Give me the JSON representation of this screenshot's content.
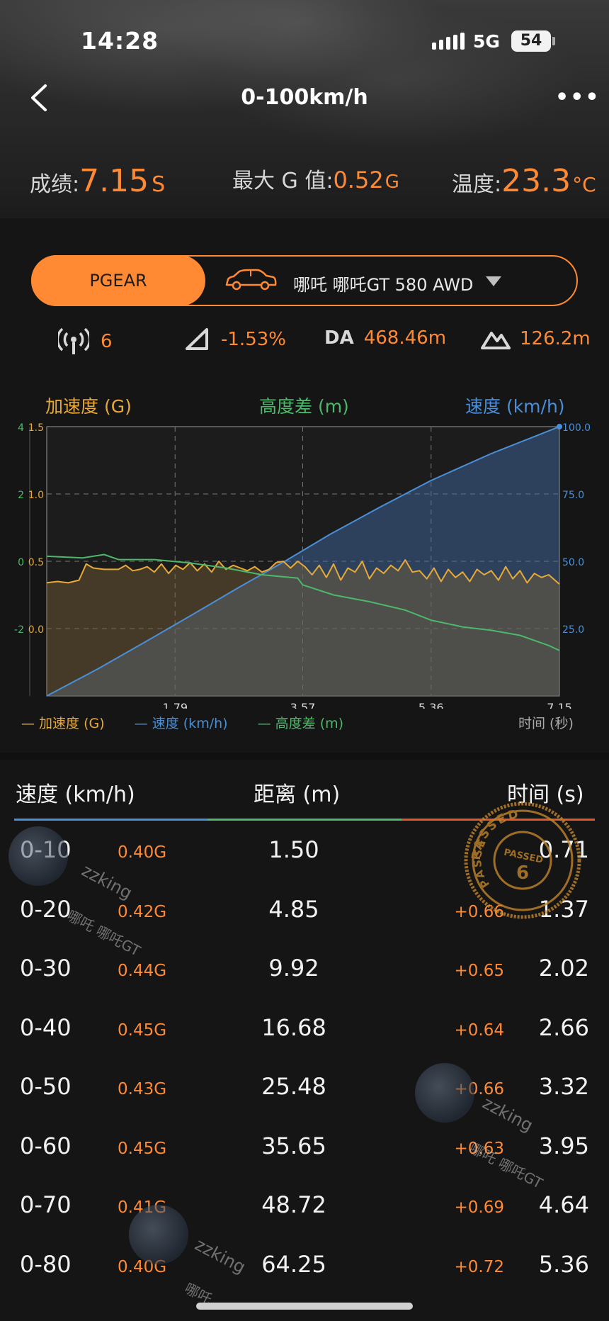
{
  "status_bar": {
    "time": "14:28",
    "network": "5G",
    "battery": "54"
  },
  "nav": {
    "title": "0-100km/h"
  },
  "metrics": [
    {
      "label": "成绩:",
      "value": "7.15",
      "unit": "S"
    },
    {
      "label": "最大 G 值:",
      "value": "0.52",
      "unit": "G"
    },
    {
      "label": "温度:",
      "value": "23.3",
      "unit": "°C"
    }
  ],
  "selector": {
    "tab_label": "PGEAR",
    "car_name": "哪吒 哪吒GT 580 AWD"
  },
  "info": {
    "satellites": "6",
    "slope": "-1.53%",
    "da_label": "DA",
    "da_value": "468.46m",
    "altitude": "126.2m"
  },
  "colors": {
    "accent": "#ff8a33",
    "accel": "#e7a93a",
    "speed": "#4a8fd8",
    "altitude": "#4cb96a",
    "stamp": "#c6872c"
  },
  "chart_headers": {
    "accel": "加速度 (G)",
    "altitude": "高度差 (m)",
    "speed": "速度 (km/h)"
  },
  "chart_data": {
    "type": "line",
    "x_label": "时间 (秒)",
    "x_ticks": [
      "1.79",
      "3.57",
      "5.36",
      "7.15"
    ],
    "xlim": [
      0,
      7.15
    ],
    "y_axes": {
      "altitude": {
        "ticks": [
          "4",
          "2",
          "0",
          "-2"
        ],
        "ylim": [
          -4,
          4
        ]
      },
      "accel": {
        "ticks": [
          "1.5",
          "1.0",
          "0.5",
          "0.0"
        ],
        "ylim": [
          -0.5,
          1.5
        ]
      },
      "speed": {
        "ticks": [
          "100.0",
          "75.0",
          "50.0",
          "25.0"
        ],
        "ylim": [
          0,
          100
        ]
      }
    },
    "grid": true,
    "series": [
      {
        "name": "速度 (km/h)",
        "axis": "speed",
        "x": [
          0,
          0.71,
          1.37,
          2.02,
          2.66,
          3.32,
          3.95,
          4.64,
          5.36,
          6.2,
          7.15
        ],
        "values": [
          0,
          10,
          20,
          30,
          40,
          50,
          60,
          70,
          80,
          90,
          100
        ]
      },
      {
        "name": "加速度 (G)",
        "axis": "accel",
        "x": [
          0,
          0.15,
          0.3,
          0.45,
          0.55,
          0.65,
          0.8,
          1.0,
          1.1,
          1.2,
          1.3,
          1.4,
          1.5,
          1.6,
          1.7,
          1.8,
          1.9,
          2.0,
          2.1,
          2.2,
          2.3,
          2.4,
          2.5,
          2.6,
          2.7,
          2.8,
          2.9,
          3.0,
          3.1,
          3.2,
          3.3,
          3.4,
          3.5,
          3.6,
          3.7,
          3.8,
          3.9,
          4.0,
          4.1,
          4.2,
          4.3,
          4.4,
          4.5,
          4.6,
          4.7,
          4.8,
          4.9,
          5.0,
          5.1,
          5.2,
          5.3,
          5.4,
          5.5,
          5.6,
          5.7,
          5.8,
          5.9,
          6.0,
          6.1,
          6.2,
          6.3,
          6.4,
          6.5,
          6.6,
          6.7,
          6.8,
          6.9,
          7.0,
          7.15
        ],
        "values": [
          0.34,
          0.35,
          0.34,
          0.36,
          0.48,
          0.45,
          0.44,
          0.44,
          0.47,
          0.43,
          0.44,
          0.46,
          0.42,
          0.48,
          0.41,
          0.47,
          0.44,
          0.49,
          0.43,
          0.48,
          0.42,
          0.5,
          0.44,
          0.47,
          0.45,
          0.43,
          0.46,
          0.42,
          0.44,
          0.49,
          0.5,
          0.45,
          0.5,
          0.46,
          0.4,
          0.47,
          0.38,
          0.48,
          0.36,
          0.45,
          0.42,
          0.5,
          0.37,
          0.45,
          0.41,
          0.47,
          0.43,
          0.51,
          0.42,
          0.43,
          0.37,
          0.45,
          0.35,
          0.44,
          0.38,
          0.42,
          0.35,
          0.44,
          0.4,
          0.43,
          0.36,
          0.46,
          0.37,
          0.43,
          0.34,
          0.41,
          0.38,
          0.4,
          0.33
        ]
      },
      {
        "name": "高度差 (m)",
        "axis": "altitude",
        "x": [
          0,
          0.5,
          0.8,
          1.0,
          1.5,
          2.0,
          2.5,
          3.0,
          3.5,
          3.57,
          4.0,
          4.5,
          5.0,
          5.36,
          5.8,
          6.2,
          6.6,
          7.0,
          7.15
        ],
        "values": [
          0.15,
          0.1,
          0.2,
          0.05,
          0.05,
          -0.05,
          -0.2,
          -0.4,
          -0.5,
          -0.7,
          -1.0,
          -1.2,
          -1.45,
          -1.75,
          -1.95,
          -2.05,
          -2.2,
          -2.5,
          -2.65
        ]
      }
    ]
  },
  "legend": [
    {
      "label": "加速度 (G)",
      "color": "#e7a93a"
    },
    {
      "label": "速度 (km/h)",
      "color": "#4a8fd8"
    },
    {
      "label": "高度差 (m)",
      "color": "#4cb96a"
    }
  ],
  "table": {
    "headers": {
      "speed": "速度 (km/h)",
      "distance": "距离 (m)",
      "time": "时间 (s)"
    },
    "rows": [
      {
        "speed": "0-10",
        "g": "0.40G",
        "distance": "1.50",
        "delta": "",
        "time": "0.71"
      },
      {
        "speed": "0-20",
        "g": "0.42G",
        "distance": "4.85",
        "delta": "+0.66",
        "time": "1.37"
      },
      {
        "speed": "0-30",
        "g": "0.44G",
        "distance": "9.92",
        "delta": "+0.65",
        "time": "2.02"
      },
      {
        "speed": "0-40",
        "g": "0.45G",
        "distance": "16.68",
        "delta": "+0.64",
        "time": "2.66"
      },
      {
        "speed": "0-50",
        "g": "0.43G",
        "distance": "25.48",
        "delta": "+0.66",
        "time": "3.32"
      },
      {
        "speed": "0-60",
        "g": "0.45G",
        "distance": "35.65",
        "delta": "+0.63",
        "time": "3.95"
      },
      {
        "speed": "0-70",
        "g": "0.41G",
        "distance": "48.72",
        "delta": "+0.69",
        "time": "4.64"
      },
      {
        "speed": "0-80",
        "g": "0.40G",
        "distance": "64.25",
        "delta": "+0.72",
        "time": "5.36"
      }
    ]
  },
  "stamp": {
    "text_top": "PASSED",
    "text_center": "PASSED",
    "text_left": "PASSED",
    "number": "6"
  },
  "watermarks": [
    {
      "user": "zzking",
      "tag": "哪吒 哪吒GT"
    },
    {
      "user": "zzking",
      "tag": "哪吒 哪吒GT"
    },
    {
      "user": "zzking",
      "tag": "哪吒"
    }
  ]
}
